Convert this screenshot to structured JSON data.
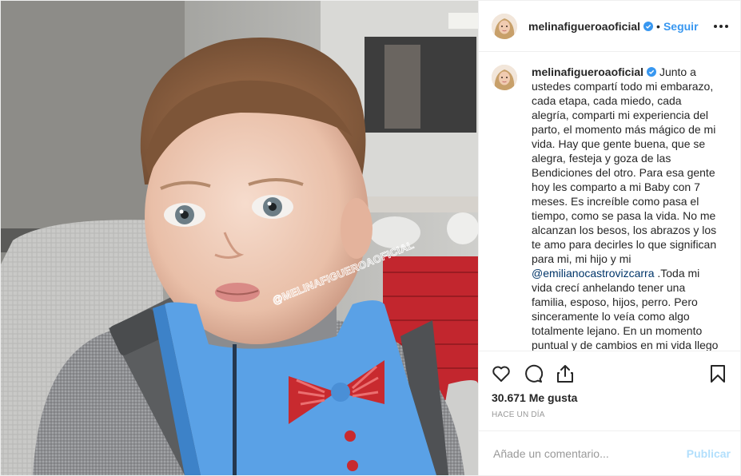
{
  "post": {
    "photo_watermark": "@MELINAFIGUEROAOFICIAL",
    "header": {
      "username": "melinafigueroaoficial",
      "separator": "•",
      "follow_label": "Seguir"
    },
    "caption": {
      "username": "melinafigueroaoficial",
      "text_part1": "Junto a ustedes compartí todo mi embarazo, cada etapa, cada miedo, cada alegría, comparti mi experiencia del parto, el momento más mágico de mi vida. Hay que gente buena, que se alegra, festeja y goza de las Bendiciones del otro. Para esa gente hoy les comparto a mi Baby con 7 meses. Es increíble como pasa el tiempo, como se pasa la vida. No me alcanzan los besos, los abrazos y los te amo para decirles lo que significan para mi, mi hijo y mi",
      "mention": "@emilianocastrovizcarra",
      "text_part2": " .Toda mi vida crecí anhelando tener una familia, esposo, hijos, perro. Pero sinceramente lo veía como algo totalmente lejano. En un momento puntual y de cambios en mi vida llego la Ola de bendiciones, sorpresas más"
    },
    "likes_text": "30.671 Me gusta",
    "time_text": "HACE UN DÍA",
    "comment_box": {
      "placeholder": "Añade un comentario...",
      "publish_label": "Publicar"
    },
    "icons": {
      "verified": "verified-badge-icon",
      "more": "more-options-icon",
      "like": "heart-icon",
      "comment": "comment-bubble-icon",
      "share": "share-icon",
      "save": "bookmark-icon"
    },
    "colors": {
      "link_blue": "#3897f0",
      "mention": "#003569",
      "publish_disabled": "#b2dffc",
      "border": "#efefef"
    }
  }
}
